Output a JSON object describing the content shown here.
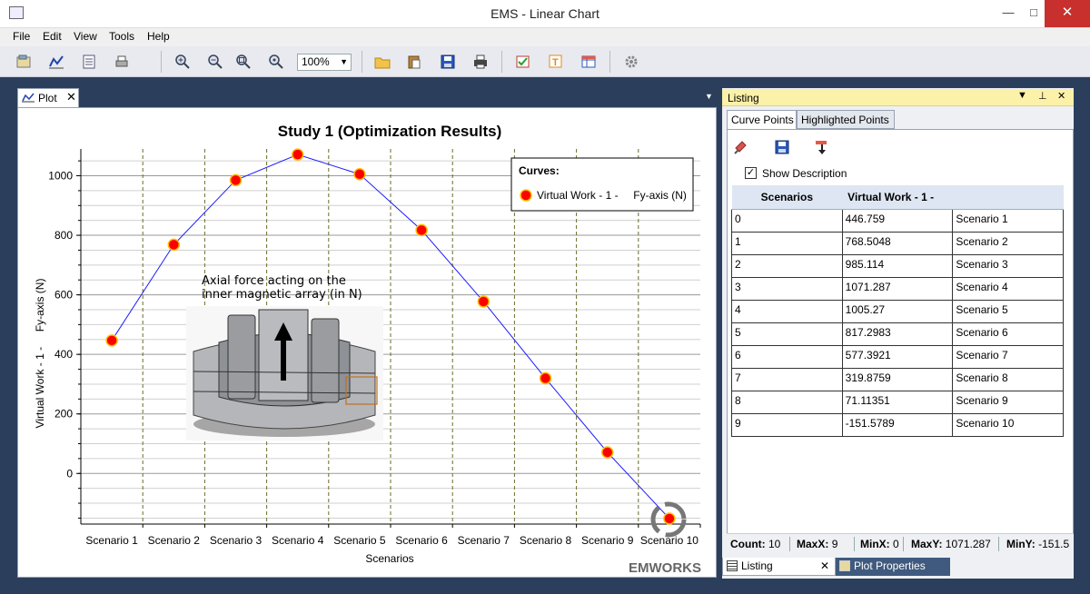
{
  "window": {
    "title": "EMS - Linear Chart"
  },
  "menu": [
    "File",
    "Edit",
    "View",
    "Tools",
    "Help"
  ],
  "toolbar": {
    "zoom_value": "100%"
  },
  "plot_tab": {
    "label": "Plot"
  },
  "listing": {
    "title": "Listing",
    "tabs": [
      "Curve Points",
      "Highlighted Points"
    ],
    "show_description": {
      "label": "Show Description",
      "checked": true
    },
    "columns": [
      "Scenarios",
      "Virtual Work - 1 -",
      ""
    ],
    "rows": [
      [
        "0",
        "446.759",
        "Scenario 1"
      ],
      [
        "1",
        "768.5048",
        "Scenario 2"
      ],
      [
        "2",
        "985.114",
        "Scenario 3"
      ],
      [
        "3",
        "1071.287",
        "Scenario 4"
      ],
      [
        "4",
        "1005.27",
        "Scenario 5"
      ],
      [
        "5",
        "817.2983",
        "Scenario 6"
      ],
      [
        "6",
        "577.3921",
        "Scenario 7"
      ],
      [
        "7",
        "319.8759",
        "Scenario 8"
      ],
      [
        "8",
        "71.11351",
        "Scenario 9"
      ],
      [
        "9",
        "-151.5789",
        "Scenario 10"
      ]
    ],
    "status": {
      "count_label": "Count:",
      "count": "10",
      "maxx_label": "MaxX:",
      "maxx": "9",
      "minx_label": "MinX:",
      "minx": "0",
      "maxy_label": "MaxY:",
      "maxy": "1071.287",
      "miny_label": "MinY:",
      "miny": "-151.5"
    }
  },
  "bottom_tabs": [
    "Listing",
    "Plot Properties"
  ],
  "annotation": {
    "line1": "Axial force acting on the",
    "line2": "inner magnetic array (in N)"
  },
  "logo_text": "EMWORKS",
  "chart_data": {
    "type": "line",
    "title": "Study 1 (Optimization Results)",
    "xlabel": "Scenarios",
    "ylabel": "Virtual Work - 1 -     Fy-axis (N)",
    "categories": [
      "Scenario 1",
      "Scenario 2",
      "Scenario 3",
      "Scenario 4",
      "Scenario 5",
      "Scenario 6",
      "Scenario 7",
      "Scenario 8",
      "Scenario 9",
      "Scenario 10"
    ],
    "series": [
      {
        "name": "Virtual Work - 1 -     Fy-axis (N)",
        "values": [
          446.759,
          768.5048,
          985.114,
          1071.287,
          1005.27,
          817.2983,
          577.3921,
          319.8759,
          71.11351,
          -151.5789
        ],
        "color": "#1a1aff",
        "marker_color": "#ff0000"
      }
    ],
    "ylim": [
      -170,
      1090
    ],
    "yticks": [
      0,
      200,
      400,
      600,
      800,
      1000
    ],
    "legend_title": "Curves:",
    "legend_position": "top-right",
    "grid": true
  },
  "colors": {
    "accent_dark": "#2b3f5c",
    "listing_header": "#fbf1a8"
  }
}
